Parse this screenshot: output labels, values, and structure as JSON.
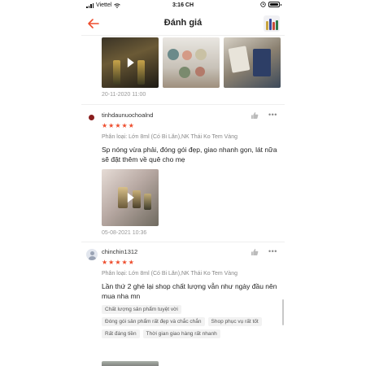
{
  "status_bar": {
    "carrier": "Viettel",
    "time": "3:16 CH"
  },
  "header": {
    "title": "Đánh giá"
  },
  "top_media": {
    "date": "20-11-2020 11:00"
  },
  "reviews": [
    {
      "username": "tinhdaunuochoalnd",
      "rating": 5,
      "variant": "Phân loại: Lớn 8ml (Có Bi Lăn),NK Thái Ko Tem Vàng",
      "comment": "Sp nóng vừa phải, đóng gói đẹp, giao nhanh gọn, lát nữa sẽ đặt thêm về quê cho mẹ",
      "date": "05-08-2021 10:36"
    },
    {
      "username": "chinchin1312",
      "rating": 5,
      "variant": "Phân loại: Lớn 8ml (Có Bi Lăn),NK Thái Ko Tem Vàng",
      "comment": "Lần thứ 2 ghé lại shop chất lượng vẫn như ngày đầu nên mua nha mn",
      "tags": [
        "Chất lượng sản phẩm tuyệt vời",
        "Đóng gói sản phẩm rất đẹp và chắc chắn",
        "Shop phục vụ rất tốt",
        "Rất đáng tiền",
        "Thời gian giao hàng rất nhanh"
      ]
    }
  ],
  "colors": {
    "accent": "#ee4d2d",
    "muted_text": "#999999",
    "tag_bg": "#f2f2f2"
  },
  "icons": [
    "back-arrow-icon",
    "wifi-icon",
    "battery-icon",
    "play-icon",
    "thumbs-up-icon",
    "more-icon",
    "star-icon",
    "avatar-icon"
  ]
}
